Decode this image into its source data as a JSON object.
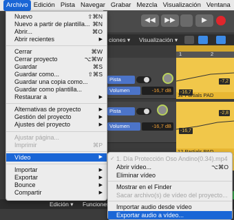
{
  "menubar": {
    "items": [
      "Archivo",
      "Edición",
      "Pista",
      "Navegar",
      "Grabar",
      "Mezcla",
      "Visualización",
      "Ventana"
    ]
  },
  "toolbar": {
    "funciones": "ciones ▾",
    "visualizacion": "Visualización ▾"
  },
  "tracks": [
    {
      "name": "Pista",
      "volume_label": "Volumen",
      "volume_value": "-16,7 dB"
    },
    {
      "name": "Pista",
      "volume_label": "Volumen",
      "volume_value": "-16,7 dB"
    }
  ],
  "ruler": {
    "marks": [
      "1",
      "2"
    ]
  },
  "regions": [
    {
      "name": "12 Partials PAD",
      "auto_values": [
        "-7,2",
        "-16,7"
      ]
    },
    {
      "name": "12 Partials PAD",
      "auto_values": [
        "-2,8",
        "-16,7"
      ]
    }
  ],
  "bottombar": {
    "edicion": "Edición ▾",
    "funciones": "Funciones"
  },
  "menu": {
    "title": "Archivo",
    "items": [
      {
        "label": "Nuevo",
        "shortcut": "⇧⌘N"
      },
      {
        "label": "Nuevo a partir de plantilla...",
        "shortcut": "⌘N"
      },
      {
        "label": "Abrir...",
        "shortcut": "⌘O"
      },
      {
        "label": "Abrir recientes",
        "arrow": "▶"
      },
      {
        "label": "Cerrar",
        "shortcut": "⌘W"
      },
      {
        "label": "Cerrar proyecto",
        "shortcut": "⌥⌘W"
      },
      {
        "label": "Guardar",
        "shortcut": "⌘S"
      },
      {
        "label": "Guardar como...",
        "shortcut": "⇧⌘S"
      },
      {
        "label": "Guardar una copia como..."
      },
      {
        "label": "Guardar como plantilla..."
      },
      {
        "label": "Restaurar a",
        "arrow": "▶"
      },
      {
        "label": "Alternativas de proyecto",
        "arrow": "▶"
      },
      {
        "label": "Gestión del proyecto",
        "arrow": "▶"
      },
      {
        "label": "Ajustes del proyecto",
        "arrow": "▶"
      },
      {
        "label": "Ajustar página..."
      },
      {
        "label": "Imprimir",
        "shortcut": "⌘P"
      },
      {
        "label": "Vídeo",
        "arrow": "▶"
      },
      {
        "label": "Importar",
        "arrow": "▶"
      },
      {
        "label": "Exportar",
        "arrow": "▶"
      },
      {
        "label": "Bounce",
        "arrow": "▶"
      },
      {
        "label": "Compartir",
        "arrow": "▶"
      }
    ]
  },
  "submenu": {
    "current_file": "1. Día Protección Oso Andino(0.34).mp4",
    "check": "✓",
    "items": [
      {
        "label": "Abrir vídeo...",
        "shortcut": "⌥⌘O"
      },
      {
        "label": "Eliminar vídeo"
      },
      {
        "label": "Mostrar en el Finder"
      },
      {
        "label": "Sacar archivo(s) de vídeo del proyecto..."
      },
      {
        "label": "Importar audio desde vídeo"
      },
      {
        "label": "Exportar audio a vídeo..."
      }
    ]
  },
  "colors": {
    "highlight": "#1a66d6",
    "region": "#f1c74a",
    "record": "#e0262c"
  }
}
